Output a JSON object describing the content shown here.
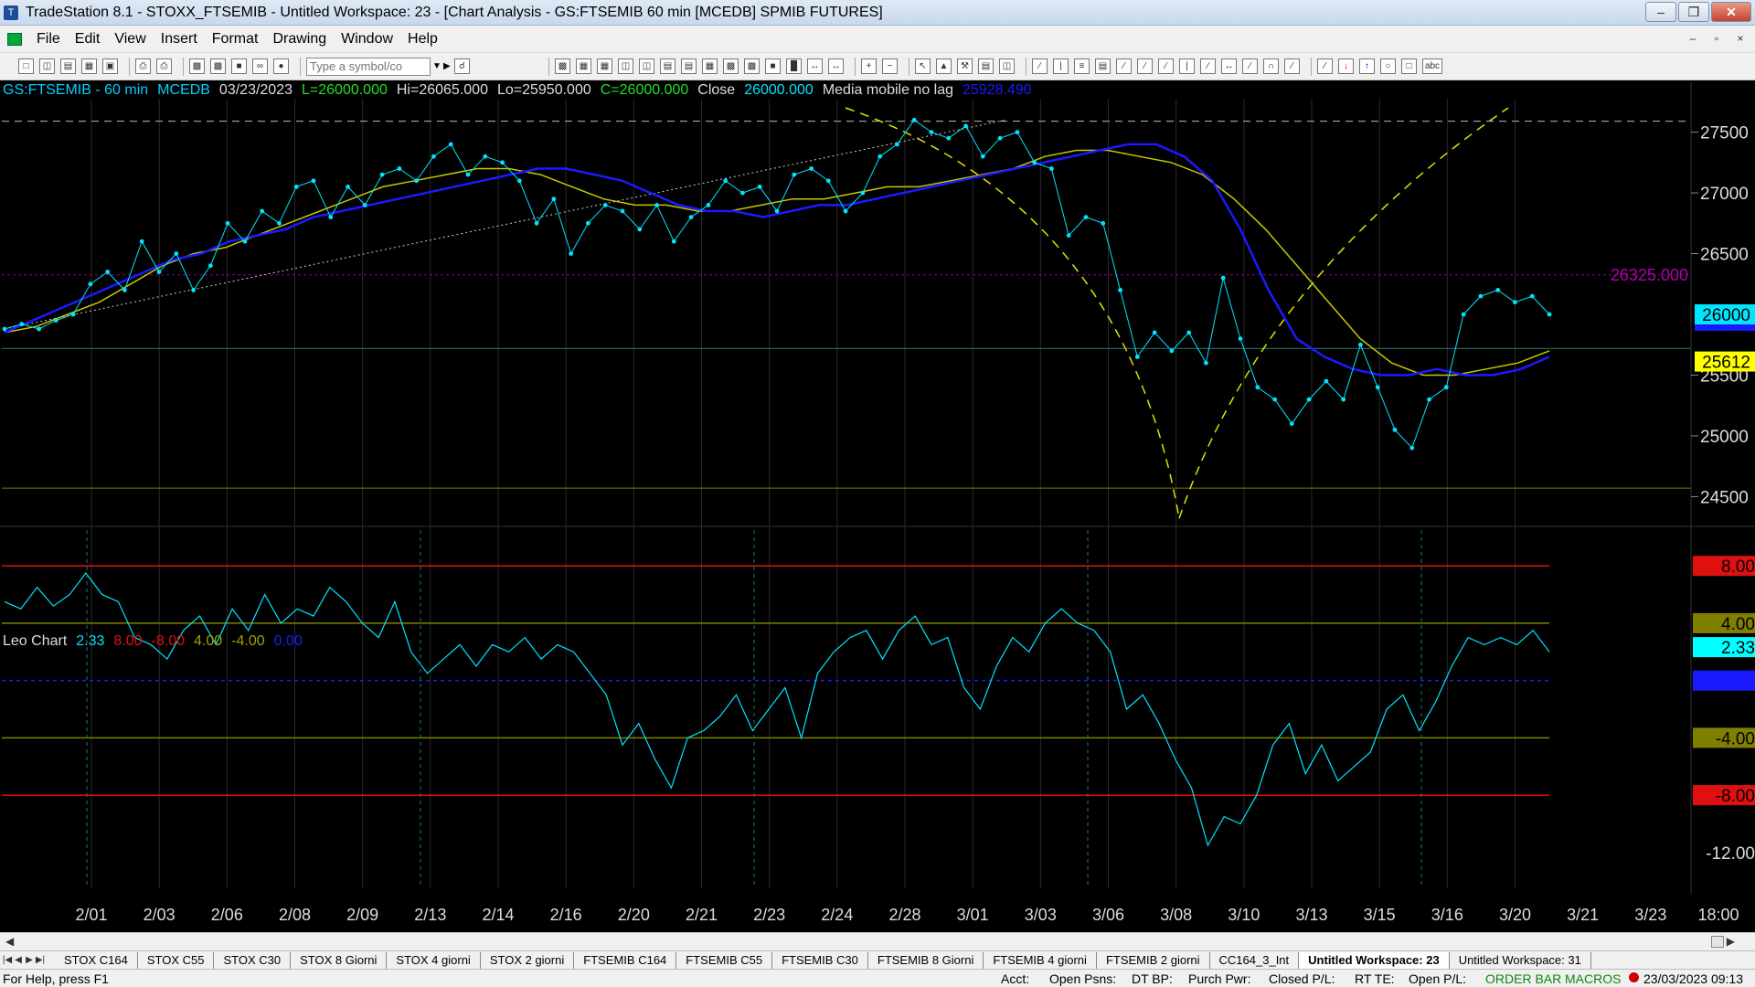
{
  "window": {
    "title": "TradeStation 8.1 - STOXX_FTSEMIB - Untitled Workspace:  23 - [Chart Analysis - GS:FTSEMIB  60 min  [MCEDB] SPMIB FUTURES]",
    "minimize": "–",
    "maximize": "❒",
    "close": "✕"
  },
  "menu": [
    "File",
    "Edit",
    "View",
    "Insert",
    "Format",
    "Drawing",
    "Window",
    "Help"
  ],
  "toolbar": {
    "symbol_placeholder": "Type a symbol/co"
  },
  "chart_header": {
    "symbol": "GS:FTSEMIB - 60 min",
    "feed": "MCEDB",
    "date": "03/23/2023",
    "last": "L=26000.000",
    "high": "Hi=26065.000",
    "low": "Lo=25950.000",
    "close": "C=26000.000",
    "close_label": "Close",
    "close_value": "26000.000",
    "ma_label": "Media mobile no lag",
    "ma_value": "25928.490"
  },
  "indicator_header": {
    "name": "Leo Chart",
    "v1": "2.33",
    "v2": "8.00",
    "v3": "-8.00",
    "v4": "4.00",
    "v5": "-4.00",
    "v6": "0.00"
  },
  "colors": {
    "price": "#00e5ff",
    "ma_blue": "#1a1aff",
    "ma_yellow": "#c8c800",
    "grid": "#2a2a2a",
    "red_band": "#e01010",
    "olive_band": "#808000"
  },
  "chart_data": [
    {
      "type": "line",
      "title": "",
      "x": [
        "2/01",
        "2/03",
        "2/06",
        "2/08",
        "2/09",
        "2/13",
        "2/14",
        "2/16",
        "2/20",
        "2/21",
        "2/23",
        "2/24",
        "2/28",
        "3/01",
        "3/03",
        "3/06",
        "3/08",
        "3/10",
        "3/13",
        "3/15",
        "3/16",
        "3/20",
        "3/21",
        "3/23",
        "18:00"
      ],
      "y_ticks": [
        27500,
        27000,
        26500,
        25500,
        25000,
        24500
      ],
      "ylim": [
        24300,
        27700
      ],
      "price_labels": [
        {
          "label": "26325.000",
          "value": 26325,
          "color": "#b000b0"
        },
        {
          "label": "26000",
          "value": 26000,
          "color": "#00e5ff"
        },
        {
          "label": "25612",
          "value": 25612,
          "color": "#ffff00"
        }
      ],
      "series": [
        {
          "values": [
            25880,
            25920,
            25880,
            25950,
            26000,
            26250,
            26350,
            26200,
            26600,
            26350,
            26500,
            26200,
            26400,
            26750,
            26600,
            26850,
            26750,
            27050,
            27100,
            26800,
            27050,
            26900,
            27150,
            27200,
            27100,
            27300,
            27400,
            27150,
            27300,
            27250,
            27100,
            26750,
            26950,
            26500,
            26750,
            26900,
            26850,
            26700,
            26900,
            26600,
            26800,
            26900,
            27100,
            27000,
            27050,
            26850,
            27150,
            27200,
            27100,
            26850,
            27000,
            27300,
            27400,
            27600,
            27500,
            27450,
            27550,
            27300,
            27450,
            27500,
            27250,
            27200,
            26650,
            26800,
            26750,
            26200,
            25650,
            25850,
            25700,
            25850,
            25600,
            26300,
            25800,
            25400,
            25300,
            25100,
            25300,
            25450,
            25300,
            25750,
            25400,
            25050,
            24900,
            25300,
            25400,
            26000,
            26150,
            26200,
            26100,
            26150,
            26000
          ]
        },
        {
          "values": [
            25850,
            25950,
            26050,
            26150,
            26250,
            26350,
            26450,
            26500,
            26600,
            26650,
            26700,
            26800,
            26850,
            26900,
            26950,
            27000,
            27050,
            27100,
            27150,
            27200,
            27200,
            27150,
            27100,
            27000,
            26900,
            26850,
            26850,
            26800,
            26850,
            26900,
            26900,
            26950,
            27000,
            27050,
            27100,
            27150,
            27200,
            27250,
            27300,
            27350,
            27400,
            27400,
            27300,
            27100,
            26700,
            26200,
            25800,
            25650,
            25550,
            25500,
            25500,
            25550,
            25500,
            25500,
            25550,
            25650
          ]
        },
        {
          "values": [
            25850,
            25900,
            26000,
            26100,
            26250,
            26400,
            26500,
            26550,
            26650,
            26750,
            26850,
            26950,
            27050,
            27100,
            27150,
            27200,
            27200,
            27150,
            27050,
            26950,
            26900,
            26900,
            26850,
            26850,
            26900,
            26950,
            26950,
            27000,
            27050,
            27050,
            27100,
            27150,
            27200,
            27300,
            27350,
            27350,
            27300,
            27250,
            27150,
            26950,
            26700,
            26400,
            26100,
            25800,
            25600,
            25500,
            25500,
            25550,
            25600,
            25700
          ]
        }
      ]
    },
    {
      "type": "line",
      "title": "",
      "y_ticks": [
        8.0,
        4.0,
        2.33,
        0.0,
        -4.0,
        -8.0,
        -12.0
      ],
      "ylim": [
        -14.5,
        10.5
      ],
      "series": [
        {
          "values": [
            5.5,
            5.0,
            6.5,
            5.2,
            6.0,
            7.5,
            6.0,
            5.5,
            3.0,
            2.5,
            1.5,
            3.5,
            4.5,
            2.5,
            5.0,
            3.5,
            6.0,
            4.0,
            5.0,
            4.5,
            6.5,
            5.5,
            4.0,
            3.0,
            5.5,
            2.0,
            0.5,
            1.5,
            2.5,
            1.0,
            2.5,
            2.0,
            3.0,
            1.5,
            2.5,
            2.0,
            0.5,
            -1.0,
            -4.5,
            -3.0,
            -5.5,
            -7.5,
            -4.0,
            -3.5,
            -2.5,
            -1.0,
            -3.5,
            -2.0,
            -0.5,
            -4.0,
            0.5,
            2.0,
            3.0,
            3.5,
            1.5,
            3.5,
            4.5,
            2.5,
            3.0,
            -0.5,
            -2.0,
            1.0,
            3.0,
            2.0,
            4.0,
            5.0,
            4.0,
            3.5,
            2.0,
            -2.0,
            -1.0,
            -3.0,
            -5.5,
            -7.5,
            -11.5,
            -9.5,
            -10.0,
            -8.0,
            -4.5,
            -3.0,
            -6.5,
            -4.5,
            -7.0,
            -6.0,
            -5.0,
            -2.0,
            -1.0,
            -3.5,
            -1.5,
            1.0,
            3.0,
            2.5,
            3.0,
            2.5,
            3.5,
            2.0
          ]
        }
      ]
    }
  ],
  "scroll": {
    "left": "◀",
    "right": "▶"
  },
  "tabs": [
    "STOX C164",
    "STOX C55",
    "STOX  C30",
    "STOX  8 Giorni",
    "STOX 4 giorni",
    "STOX  2 giorni",
    "FTSEMIB C164",
    "FTSEMIB C55",
    "FTSEMIB C30",
    "FTSEMIB  8 Giorni",
    "FTSEMIB  4 giorni",
    "FTSEMIB  2 giorni",
    "CC164_3_Int",
    "Untitled Workspace:  23",
    "Untitled Workspace:  31"
  ],
  "status": {
    "help": "For Help, press F1",
    "acct": "Acct:",
    "open_psns": "Open Psns:",
    "dt_bp": "DT BP:",
    "purch_pwr": "Purch Pwr:",
    "closed_pl": "Closed P/L:",
    "rt_te": "RT TE:",
    "open_pl": "Open P/L:",
    "order_bar": "ORDER BAR",
    "macros": "MACROS",
    "datetime": "23/03/2023 09:13"
  }
}
